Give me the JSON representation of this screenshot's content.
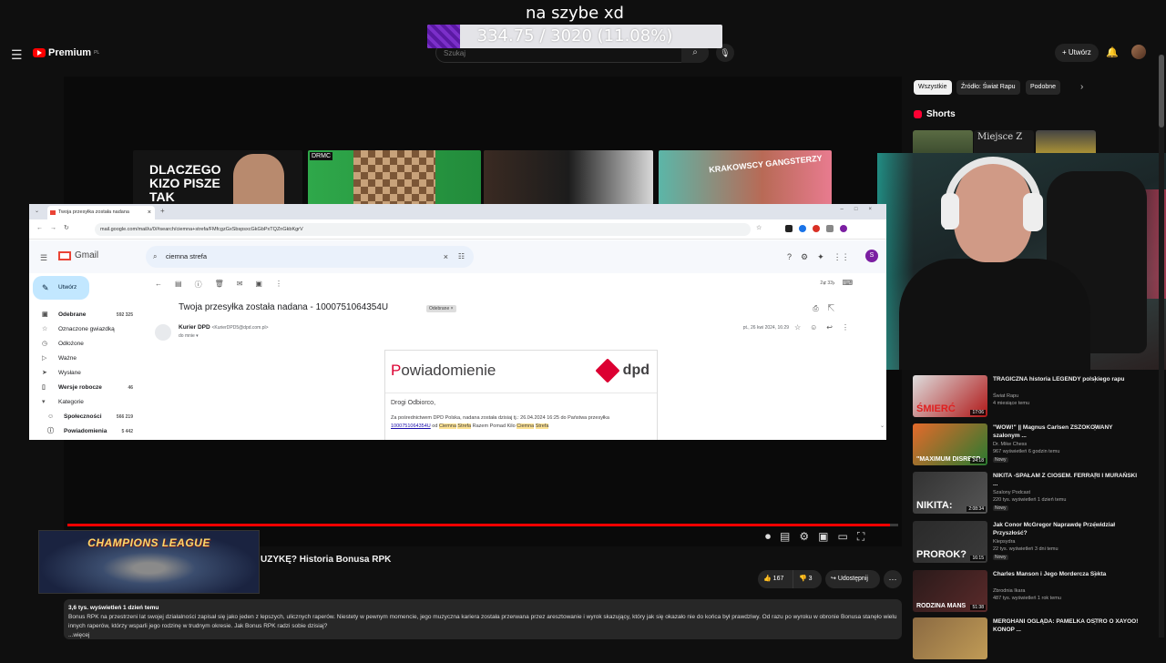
{
  "overlay": {
    "title": "na szybe xd",
    "progress_text": "334.75 / 3020 (11.08%)",
    "progress_fraction": 0.1108,
    "fill_color": "#7b2fc9"
  },
  "youtube": {
    "logo": "Premium",
    "logo_sup": "PL",
    "search_placeholder": "Szukaj",
    "create_label": "Utwórz",
    "menu_icon": "hamburger-icon",
    "video_progress": 0.99,
    "video_title_visible": "UZYKĘ? Historia Bonusa RPK",
    "cl_image_text": "CHAMPIONS LEAGUE",
    "likes": "167",
    "dislikes": "3",
    "share_label": "Udostępnij",
    "description_meta": "3,6 tys. wyświetleń  1 dzień temu",
    "description": "Bonus RPK na przestrzeni lat swojej działalności zapisał się jako jeden z lepszych, ulicznych raperów. Niestety w pewnym momencie, jego muzyczna kariera została przerwana przez aresztowanie i wyrok skazujący, który jak się okazało nie do końca był prawdziwy. Od razu po wyroku w obronie Bonusa stanęło wielu innych raperów, którzy wsparli jego rodzinę w trudnym okresie. Jak Bonus RPK radzi sobie dzisiaj?",
    "description_more": "...więcej",
    "player_thumbs": {
      "th1_text": "DLACZEGO KIZO PISZE TAK",
      "th2_tag": "DRMC",
      "th4_text": "KRAKOWSCY GANGSTERZY"
    }
  },
  "sidebar_right": {
    "chips": [
      "Wszystkie",
      "Źródło: Świat Rapu",
      "Podobne"
    ],
    "shorts_title": "Shorts",
    "short_text": "Miejsce Z",
    "recommendations": [
      {
        "title": "TRAGICZNA historia LEGENDY polskiego rapu",
        "channel": "Świat Rapu",
        "views": "",
        "age": "4 miesiące temu",
        "duration": "17:06",
        "big": "ŚMIERĆ",
        "badge": "",
        "colors": [
          "#ddd",
          "#b01818"
        ]
      },
      {
        "title": "\"WOW!\" || Magnus Carlsen ZSZOKOWANY szalonym ...",
        "channel": "Dr. Mike Chess",
        "views": "967 wyświetleń",
        "age": "6 godzin temu",
        "duration": "24:18",
        "big": "\"MAXIMUM DISRESP",
        "badge": "Nowy",
        "colors": [
          "#e46a2b",
          "#2a7a30"
        ]
      },
      {
        "title": "NIKITA -SPAŁAM Z CIOSEM. FERRARI I MURAŃSKI ...",
        "channel": "Szalony Podcast",
        "views": "220 tys. wyświetleń",
        "age": "1 dzień temu",
        "duration": "2:08:34",
        "big": "NIKITA:",
        "badge": "Nowy",
        "colors": [
          "#333",
          "#555"
        ]
      },
      {
        "title": "Jak Conor McGregor Naprawdę Przewidział Przyszłość?",
        "channel": "Klepsydra",
        "views": "22 tys. wyświetleń",
        "age": "3 dni temu",
        "duration": "16:15",
        "big": "PROROK?",
        "badge": "Nowy",
        "colors": [
          "#2a2a2a",
          "#3a3a3a"
        ]
      },
      {
        "title": "Charles Manson i Jego Mordercza Sekta",
        "channel": "Zbrodnia Ikara",
        "views": "487 tys. wyświetleń",
        "age": "1 rok temu",
        "duration": "51:38",
        "big": "RODZINA MANS",
        "badge": "",
        "colors": [
          "#2a1a1a",
          "#5a2a2a"
        ]
      },
      {
        "title": "MERGHANI OGLĄDA: PAMELKA OSTRO O XAYOO! KONOP ...",
        "channel": "",
        "views": "",
        "age": "",
        "duration": "",
        "big": "",
        "badge": "",
        "colors": [
          "#8b6a42",
          "#c09b56"
        ]
      }
    ]
  },
  "gmail": {
    "tab_title": "Twoja przesyłka została nadana",
    "url": "mail.google.com/mail/u/0/#search/ciemna+strefa/FMfcgzGxSbspsxcGkGbPxTQZnGkbKgrV",
    "logo": "Gmail",
    "search_value": "ciemna strefa",
    "compose": "Utwórz",
    "folders": [
      {
        "label": "Odebrane",
        "count": "592 325",
        "icon": "▣",
        "bold": true,
        "sub": false
      },
      {
        "label": "Oznaczone gwiazdką",
        "count": "",
        "icon": "☆",
        "bold": false,
        "sub": false
      },
      {
        "label": "Odłożone",
        "count": "",
        "icon": "◷",
        "bold": false,
        "sub": false
      },
      {
        "label": "Ważne",
        "count": "",
        "icon": "▷",
        "bold": false,
        "sub": false
      },
      {
        "label": "Wysłane",
        "count": "",
        "icon": "➤",
        "bold": false,
        "sub": false
      },
      {
        "label": "Wersje robocze",
        "count": "46",
        "icon": "▯",
        "bold": true,
        "sub": false
      },
      {
        "label": "Kategorie",
        "count": "",
        "icon": "▾",
        "bold": false,
        "sub": false
      },
      {
        "label": "Społeczności",
        "count": "566 219",
        "icon": "☺",
        "bold": true,
        "sub": true
      },
      {
        "label": "Powiadomienia",
        "count": "5 442",
        "icon": "ⓘ",
        "bold": true,
        "sub": true
      }
    ],
    "pager": "2 z 33",
    "subject": "Twoja przesyłka została nadana - 1000751064354U",
    "label": "Odebrane ×",
    "sender": "Kurier DPD",
    "sender_email": "<KurierDPD5@dpd.com.pl>",
    "to": "do mnie ▾",
    "date": "pt., 26 kwi 2024, 16:29",
    "card_title_first": "P",
    "card_title_rest": "owiadomienie",
    "card_logo": "dpd",
    "greeting": "Drogi Odbiorco,",
    "body_line1": "Za pośrednictwem DPD Polska, nadana została dzisiaj tj.: 26.04.2024 16:25 do Państwa przesyłka",
    "tracking": "1000751064354U",
    "body_od": " od ",
    "hl1": "Ciemna",
    "hl2": "Strefa",
    "body_mid": " Razem Pomad Kilo ",
    "hl3": "Ciemna",
    "hl4": "Strefa"
  }
}
